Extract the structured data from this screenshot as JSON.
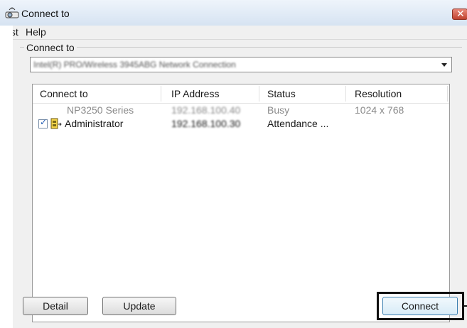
{
  "window": {
    "title": "Connect to",
    "app_icon": "projector-icon",
    "close_icon": "close-icon"
  },
  "menu": {
    "items": [
      "List",
      "Help"
    ]
  },
  "group": {
    "label": "Connect to",
    "dropdown": {
      "value": "Intel(R) PRO/Wireless 3945ABG Network Connection",
      "arrow_icon": "chevron-down-icon"
    }
  },
  "list": {
    "columns": [
      "Connect to",
      "IP Address",
      "Status",
      "Resolution"
    ],
    "rows": [
      {
        "checked": false,
        "name": "NP3250 Series",
        "ip": "192.168.100.40",
        "status": "Busy",
        "resolution": "1024 x 768"
      },
      {
        "checked": true,
        "name": "Administrator",
        "ip": "192.168.100.30",
        "status": "Attendance ...",
        "resolution": ""
      }
    ]
  },
  "buttons": {
    "detail": "Detail",
    "update": "Update",
    "connect": "Connect"
  },
  "colors": {
    "highlight": "#111111",
    "title_bar": "#dce7f3",
    "disabled_text": "#8a8a8a"
  }
}
